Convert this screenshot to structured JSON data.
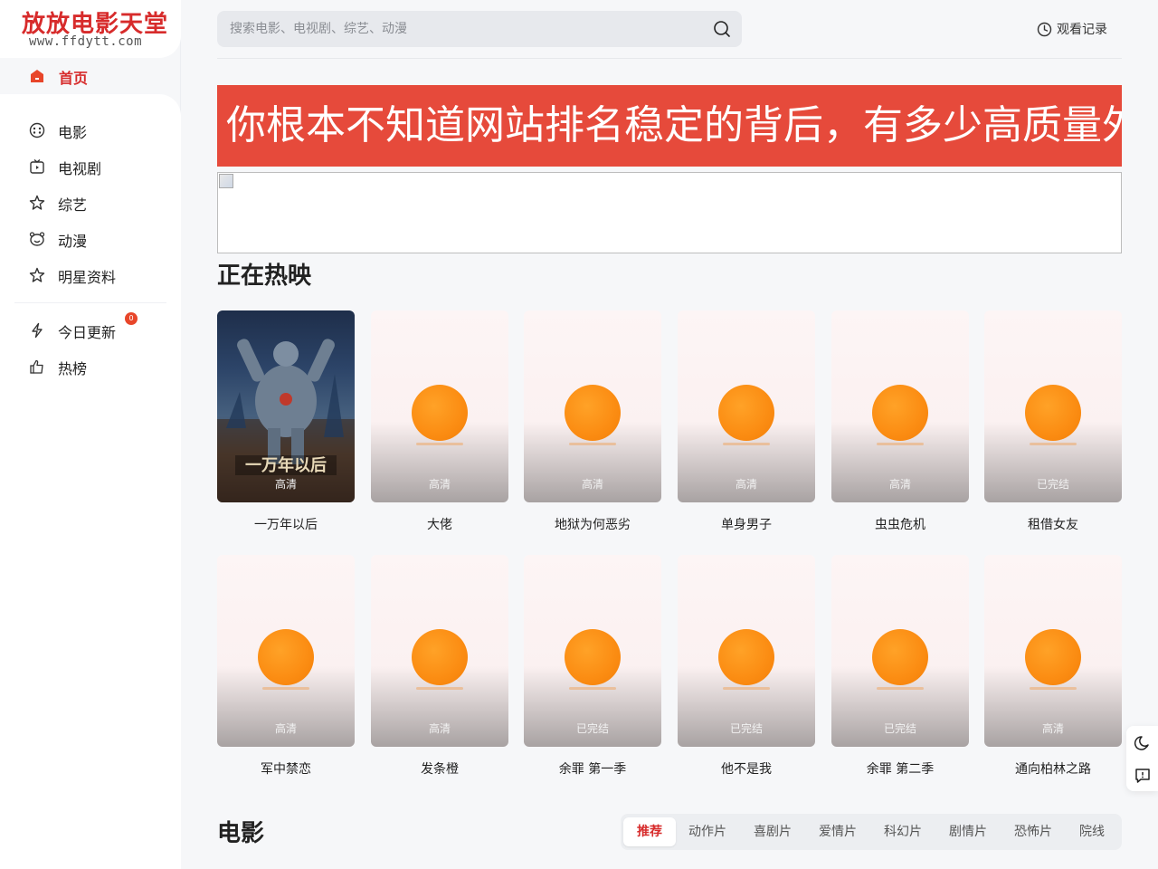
{
  "logo": {
    "title": "放放电影天堂",
    "url": "www.ffdytt.com"
  },
  "nav": {
    "home": "首页",
    "items": [
      {
        "label": "电影",
        "icon": "film-reel-icon"
      },
      {
        "label": "电视剧",
        "icon": "tv-icon"
      },
      {
        "label": "综艺",
        "icon": "star-icon"
      },
      {
        "label": "动漫",
        "icon": "bear-icon"
      },
      {
        "label": "明星资料",
        "icon": "star-icon"
      }
    ],
    "extra": [
      {
        "label": "今日更新",
        "icon": "lightning-icon",
        "badge": "0"
      },
      {
        "label": "热榜",
        "icon": "thumbs-up-icon"
      }
    ]
  },
  "search": {
    "placeholder": "搜索电影、电视剧、综艺、动漫"
  },
  "header": {
    "history": "观看记录"
  },
  "banner": {
    "text": "你根本不知道网站排名稳定的背后，有多少高质量外链的支撑！"
  },
  "now_showing": {
    "title": "正在热映",
    "cards": [
      {
        "title": "一万年以后",
        "tag": "高清"
      },
      {
        "title": "大佬",
        "tag": "高清"
      },
      {
        "title": "地狱为何恶劣",
        "tag": "高清"
      },
      {
        "title": "单身男子",
        "tag": "高清"
      },
      {
        "title": "虫虫危机",
        "tag": "高清"
      },
      {
        "title": "租借女友",
        "tag": "已完结"
      },
      {
        "title": "军中禁恋",
        "tag": "高清"
      },
      {
        "title": "发条橙",
        "tag": "高清"
      },
      {
        "title": "余罪 第一季",
        "tag": "已完结"
      },
      {
        "title": "他不是我",
        "tag": "已完结"
      },
      {
        "title": "余罪 第二季",
        "tag": "已完结"
      },
      {
        "title": "通向柏林之路",
        "tag": "高清"
      }
    ]
  },
  "movies": {
    "title": "电影",
    "tabs": [
      "推荐",
      "动作片",
      "喜剧片",
      "爱情片",
      "科幻片",
      "剧情片",
      "恐怖片",
      "院线"
    ]
  },
  "colors": {
    "accent": "#d72b2b",
    "banner": "#e64a3b",
    "placeholder_sun": "#fb8c12"
  }
}
